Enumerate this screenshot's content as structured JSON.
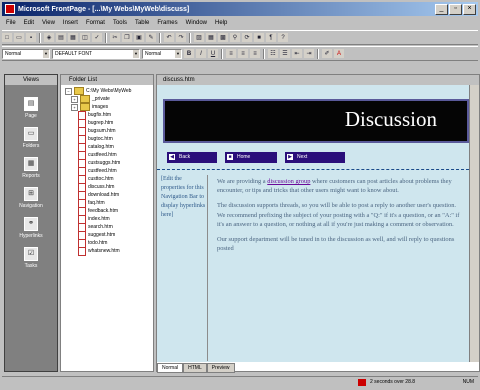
{
  "window": {
    "title": "Microsoft FrontPage - [...\\My Webs\\MyWeb\\discuss]"
  },
  "menu": [
    "File",
    "Edit",
    "View",
    "Insert",
    "Format",
    "Tools",
    "Table",
    "Frames",
    "Window",
    "Help"
  ],
  "toolbar2": {
    "style_value": "Normal",
    "font_value": "DEFAULT FONT",
    "size_value": "Normal"
  },
  "views": {
    "header": "Views",
    "items": [
      "Page",
      "Folders",
      "Reports",
      "Navigation",
      "Hyperlinks",
      "Tasks"
    ],
    "icons": [
      "page-icon",
      "folders-icon",
      "reports-icon",
      "navigation-icon",
      "hyperlinks-icon",
      "tasks-icon"
    ]
  },
  "folders": {
    "header": "Folder List",
    "root": "C:\\My Webs\\MyWeb",
    "items": [
      "_private",
      "images",
      "bugfix.htm",
      "bugrep.htm",
      "bugsum.htm",
      "bugtoc.htm",
      "catalog.htm",
      "custfeed.htm",
      "custsuggs.htm",
      "custfeed.htm",
      "custtoc.htm",
      "discuss.htm",
      "download.htm",
      "faq.htm",
      "feedback.htm",
      "index.htm",
      "search.htm",
      "suggest.htm",
      "todo.htm",
      "whatsnew.htm"
    ]
  },
  "editor": {
    "header": "discuss.htm",
    "banner_title": "Discussion",
    "nav": [
      "Back",
      "Home",
      "Next"
    ],
    "sidebar": "[Edit the properties for this Navigation Bar to display hyperlinks here]",
    "para1_pre": "We are providing a ",
    "para1_link": "discussion group",
    "para1_post": " where customers can post articles about problems they encounter, or tips and tricks that other users might want to know about.",
    "para2": "The discussion supports threads, so you will be able to post a reply to another user's question. We recommend prefixing the subject of your posting with a \"Q:\" if it's a question, or an \"A:\" if it's an answer to a question, or nothing at all if you're just making a comment or observation.",
    "para3": "Our support department will be tuned in to the discussion as well, and will reply to questions posted"
  },
  "tabs": [
    "Normal",
    "HTML",
    "Preview"
  ],
  "status": {
    "text": "2 seconds over 28.8",
    "mode": "NUM"
  }
}
